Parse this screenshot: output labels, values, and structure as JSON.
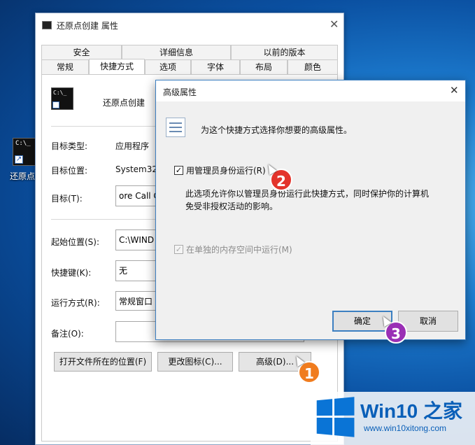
{
  "desktop": {
    "icon_label": "还原点",
    "icon_prompt": "C:\\_"
  },
  "properties": {
    "title": "还原点创建 属性",
    "tabs_top": [
      "安全",
      "详细信息",
      "以前的版本"
    ],
    "tabs_bottom": [
      "常规",
      "快捷方式",
      "选项",
      "字体",
      "布局",
      "颜色"
    ],
    "active_tab": "快捷方式",
    "shortcut_name": "还原点创建",
    "rows": {
      "target_type_label": "目标类型:",
      "target_type_value": "应用程序",
      "target_location_label": "目标位置:",
      "target_location_value": "System32",
      "target_label": "目标(T):",
      "target_value": "ore Call C",
      "start_in_label": "起始位置(S):",
      "start_in_value": "C:\\WIND",
      "hotkey_label": "快捷键(K):",
      "hotkey_value": "无",
      "run_label": "运行方式(R):",
      "run_value": "常规窗口",
      "comment_label": "备注(O):",
      "comment_value": ""
    },
    "buttons": {
      "open_location": "打开文件所在的位置(F)",
      "change_icon": "更改图标(C)...",
      "advanced": "高级(D)..."
    }
  },
  "advanced_dialog": {
    "title": "高级属性",
    "description": "为这个快捷方式选择你想要的高级属性。",
    "run_as_admin": {
      "label": "用管理员身份运行(R)",
      "checked": true
    },
    "explanation_line1": "此选项允许你以管理员身份运行此快捷方式，同时保护你的计算机",
    "explanation_line2": "免受非授权活动的影响。",
    "separate_memory": {
      "label": "在单独的内存空间中运行(M)",
      "checked": true,
      "disabled": true
    },
    "ok": "确定",
    "cancel": "取消"
  },
  "badges": {
    "step1": "1",
    "step2": "2",
    "step3": "3",
    "color_orange": "#f07c1e",
    "color_red": "#e3342c",
    "color_purple": "#9a2fb5"
  },
  "branding": {
    "win10": "Win10",
    "zhijia": "之家",
    "url": "www.win10xitong.com",
    "logo_color": "#0a74d6"
  },
  "icons": {
    "check": "✓",
    "close": "✕",
    "arrow": "↗"
  }
}
